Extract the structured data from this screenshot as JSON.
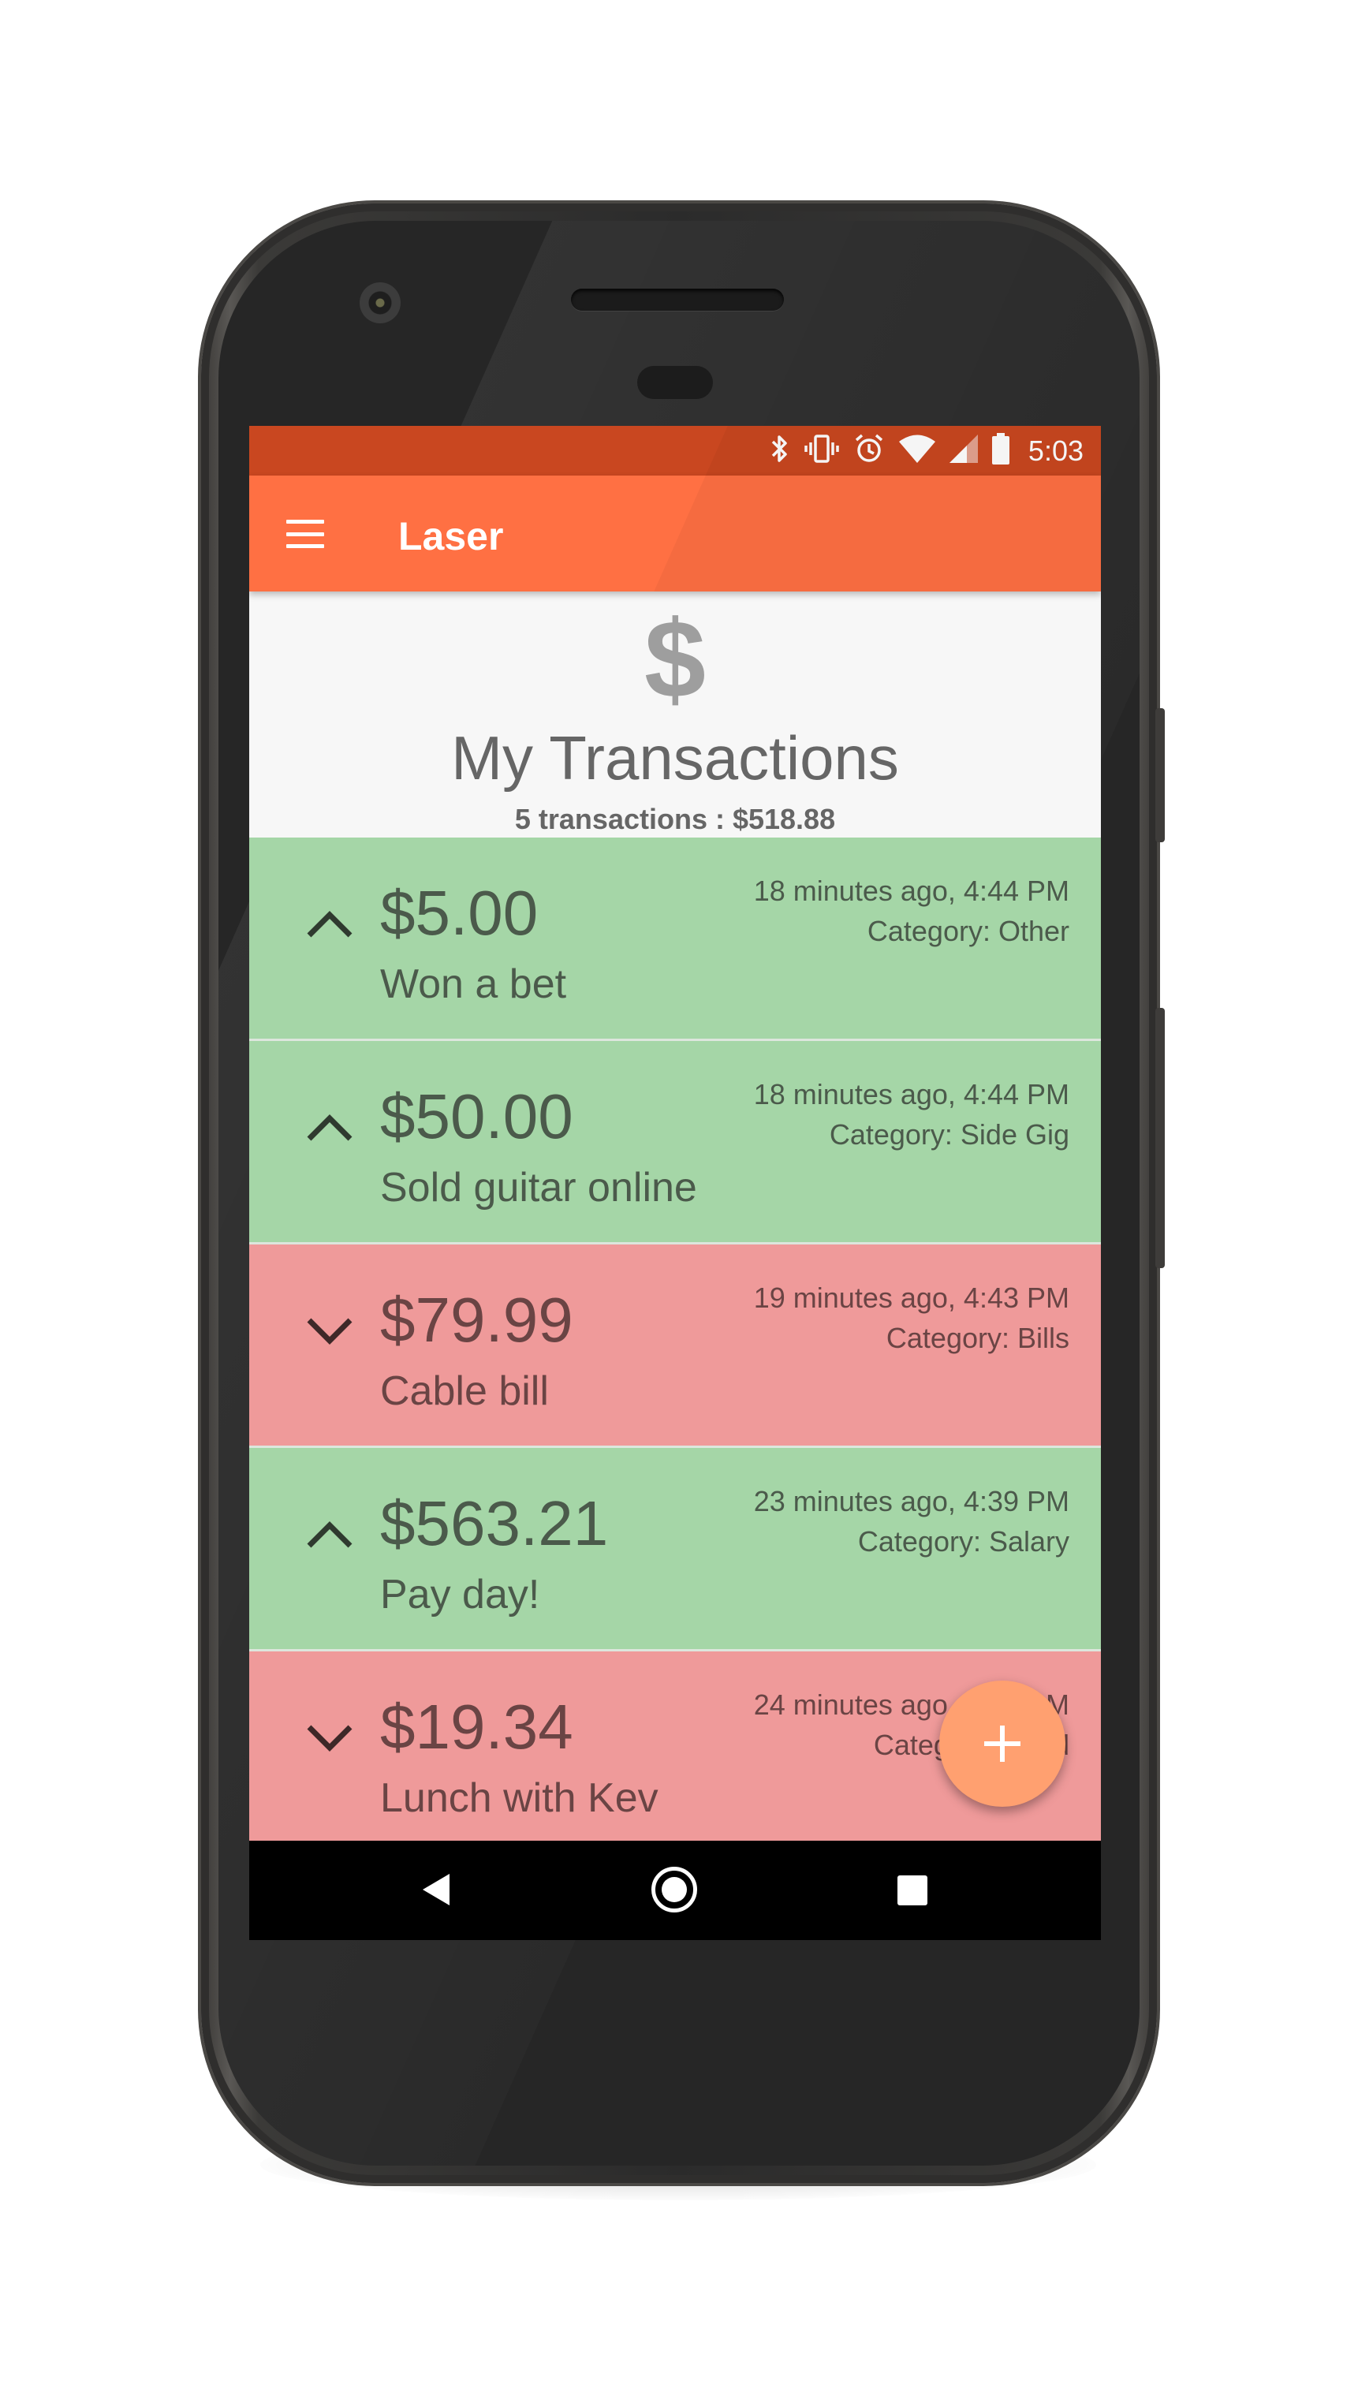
{
  "status_bar": {
    "icons": [
      "bluetooth-icon",
      "vibrate-icon",
      "alarm-icon",
      "wifi-icon",
      "signal-icon",
      "battery-icon"
    ],
    "time": "5:03",
    "color": "#c94720"
  },
  "toolbar": {
    "title": "Laser",
    "color": "#ff7043"
  },
  "header": {
    "icon": "dollar-icon",
    "icon_glyph": "$",
    "title": "My Transactions",
    "summary": "5 transactions : $518.88"
  },
  "transactions": [
    {
      "type": "income",
      "direction_icon": "chevron-up-icon",
      "amount": "$5.00",
      "description": "Won a bet",
      "time": "18 minutes ago, 4:44 PM",
      "category": "Category: Other"
    },
    {
      "type": "income",
      "direction_icon": "chevron-up-icon",
      "amount": "$50.00",
      "description": "Sold guitar online",
      "time": "18 minutes ago, 4:44 PM",
      "category": "Category: Side Gig"
    },
    {
      "type": "expense",
      "direction_icon": "chevron-down-icon",
      "amount": "$79.99",
      "description": "Cable bill",
      "time": "19 minutes ago, 4:43 PM",
      "category": "Category: Bills"
    },
    {
      "type": "income",
      "direction_icon": "chevron-up-icon",
      "amount": "$563.21",
      "description": "Pay day!",
      "time": "23 minutes ago, 4:39 PM",
      "category": "Category: Salary"
    },
    {
      "type": "expense",
      "direction_icon": "chevron-down-icon",
      "amount": "$19.34",
      "description": "Lunch with Kev",
      "time": "24 minutes ago, 4:38 PM",
      "category": "Category: Food"
    }
  ],
  "colors": {
    "income": "#a5d6a7",
    "expense": "#ef9a9a",
    "fab": "#ffa070"
  },
  "fab": {
    "icon": "plus-icon"
  },
  "nav_bar": {
    "icons": [
      "back-icon",
      "home-icon",
      "recents-icon"
    ]
  }
}
